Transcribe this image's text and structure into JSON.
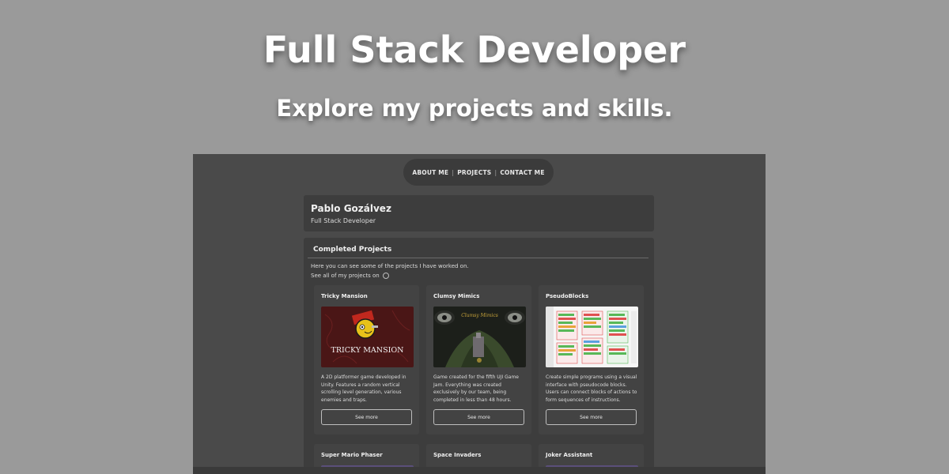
{
  "hero": {
    "title": "Full Stack Developer",
    "subtitle": "Explore my projects and skills."
  },
  "nav": {
    "items": [
      "ABOUT ME",
      "PROJECTS",
      "CONTACT ME"
    ]
  },
  "profile": {
    "name": "Pablo Gozálvez",
    "role": "Full Stack Developer"
  },
  "projects_section": {
    "title": "Completed Projects",
    "intro": "Here you can see some of the projects I have worked on.",
    "all_projects_text": "See all of my projects on",
    "github_icon": "github-icon",
    "projects": [
      {
        "title": "Tricky Mansion",
        "image_text": "TRICKY MANSION",
        "description": "A 2D platformer game developed in Unity. Features a random vertical scrolling level generation, various enemies and traps.",
        "button": "See more"
      },
      {
        "title": "Clumsy Mimics",
        "image_text": "Clumsy Mimics",
        "description": "Game created for the fifth UJI Game Jam. Everything was created exclusively by our team, being completed in less than 48 hours.",
        "button": "See more"
      },
      {
        "title": "PseudoBlocks",
        "description": "Create simple programs using a visual interface with pseudocode blocks. Users can connect blocks of actions to form sequences of instructions.",
        "button": "See more"
      }
    ],
    "more_projects": [
      {
        "title": "Super Mario Phaser"
      },
      {
        "title": "Space Invaders"
      },
      {
        "title": "Joker Assistant"
      }
    ]
  },
  "colors": {
    "page_background": "#9a9a9a",
    "screenshot_background": "#4a4a4a",
    "card_background": "#3d3d3d"
  }
}
